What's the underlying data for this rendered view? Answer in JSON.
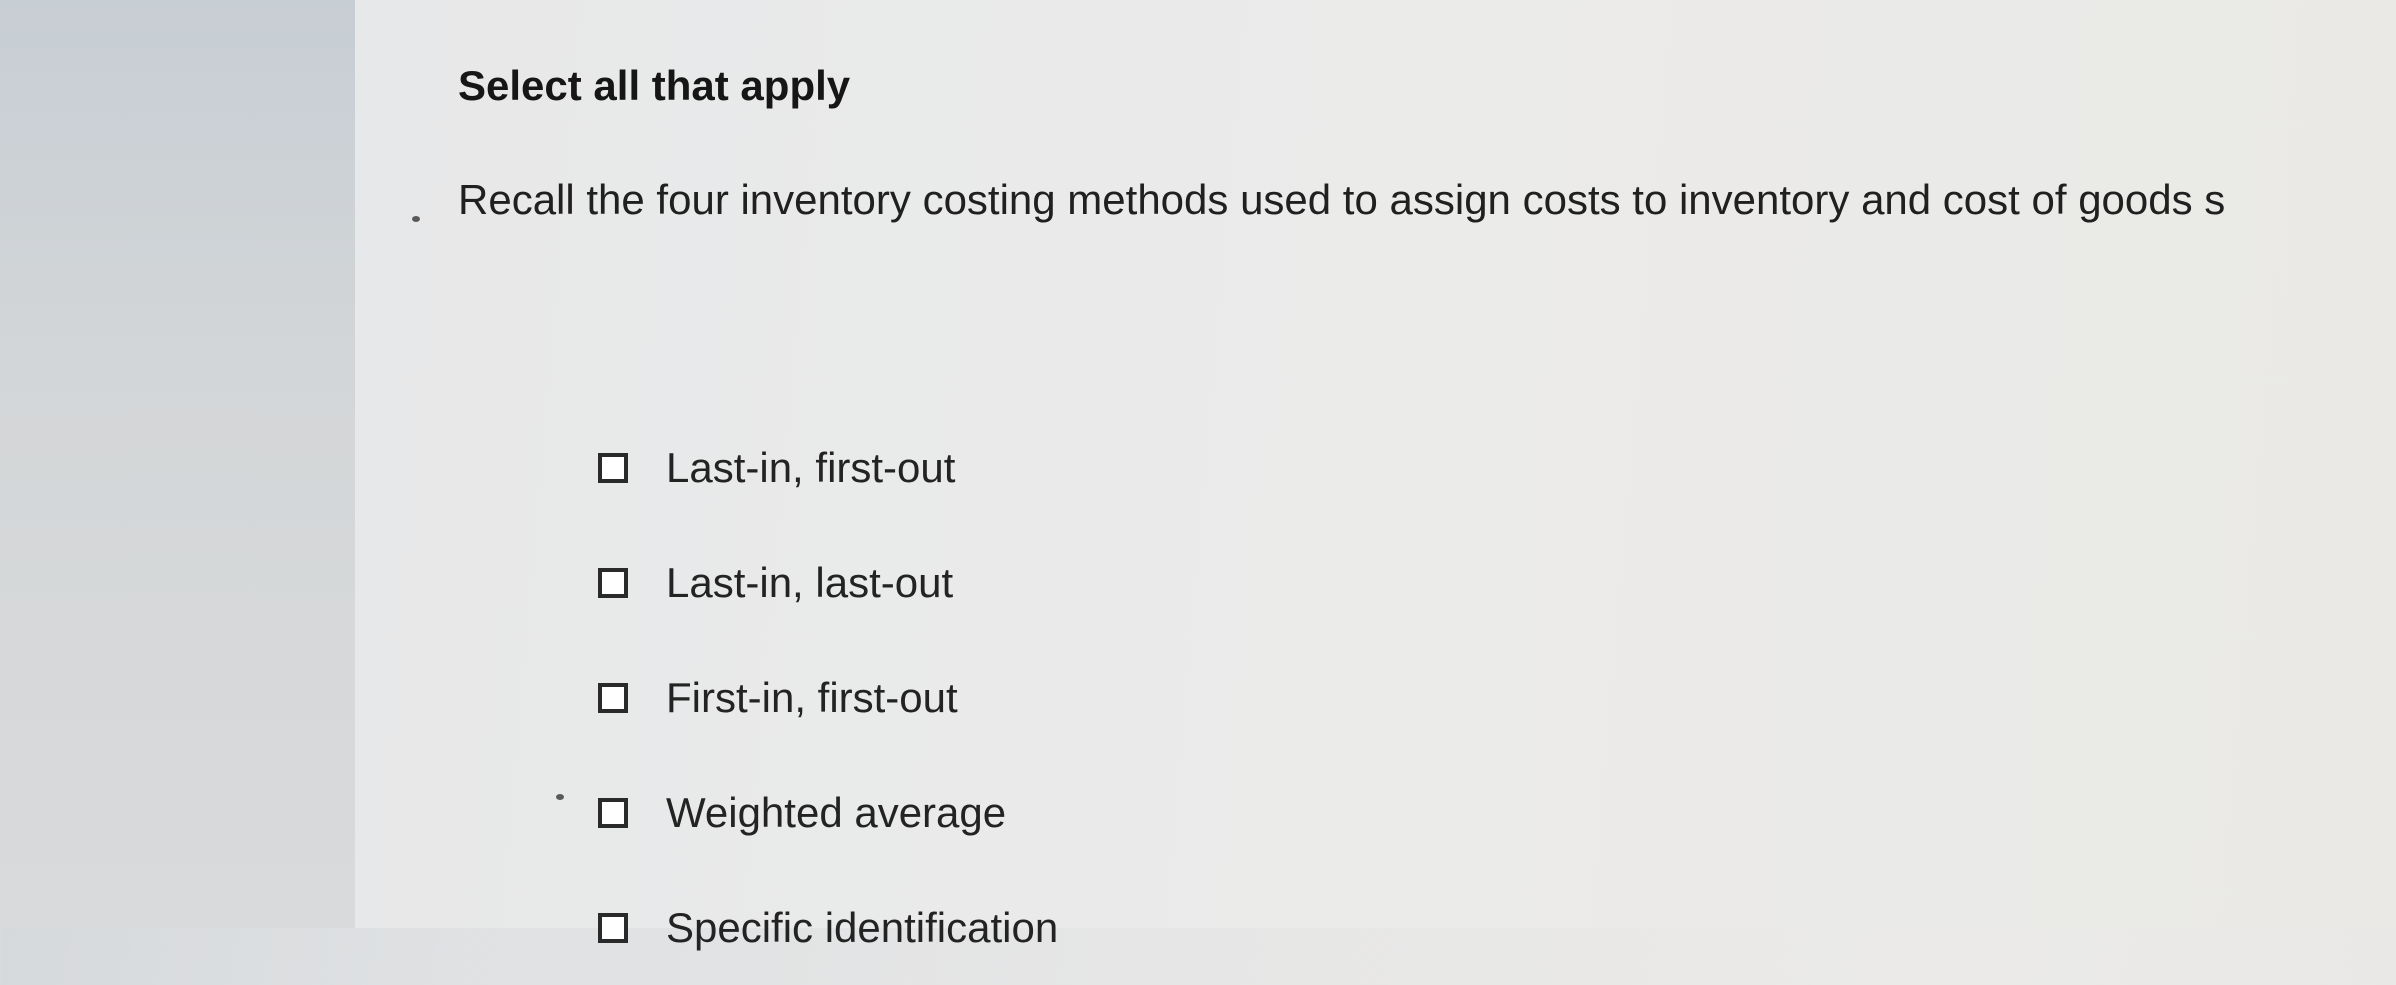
{
  "question": {
    "instruction": "Select all that apply",
    "prompt": "Recall the four inventory costing methods used to assign costs to inventory and cost of goods s"
  },
  "options": [
    {
      "label": "Last-in, first-out",
      "checked": false
    },
    {
      "label": "Last-in, last-out",
      "checked": false
    },
    {
      "label": "First-in, first-out",
      "checked": false
    },
    {
      "label": "Weighted average",
      "checked": false
    },
    {
      "label": "Specific identification",
      "checked": false
    }
  ]
}
